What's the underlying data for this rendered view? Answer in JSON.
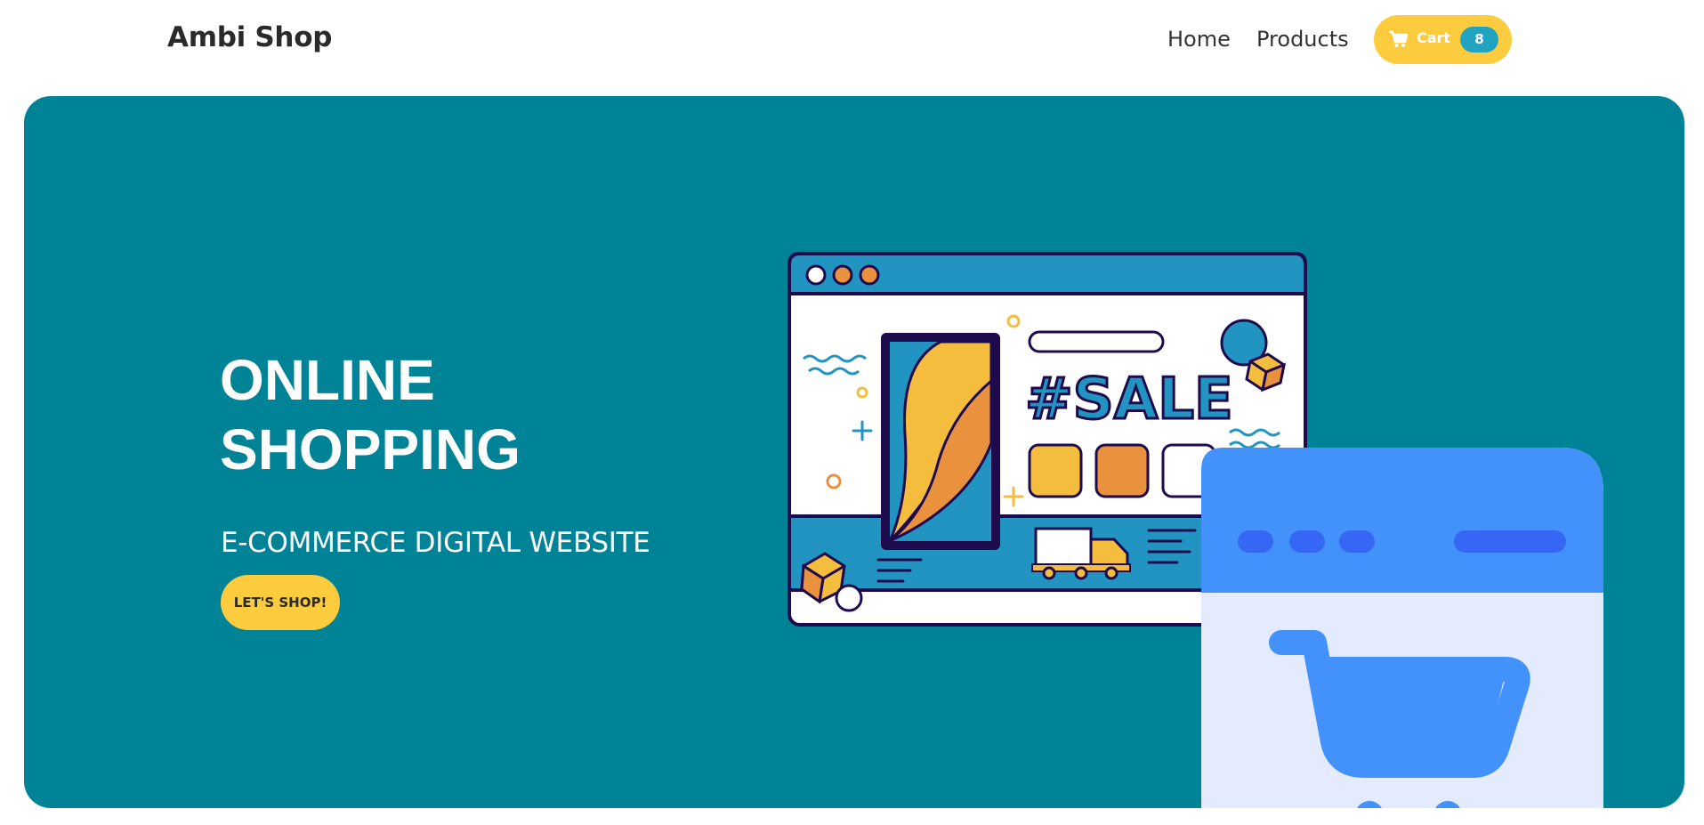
{
  "brand": "Ambi Shop",
  "nav": {
    "home": "Home",
    "products": "Products",
    "cart_label": "Cart",
    "cart_count": "8"
  },
  "hero": {
    "title_line1": "ONLINE",
    "title_line2": "SHOPPING",
    "subtitle": "E-COMMERCE DIGITAL WEBSITE",
    "button": "LET'S SHOP!",
    "illustration_text": "#SALE"
  },
  "colors": {
    "hero_bg": "#008396",
    "accent_yellow": "#fdcc3e",
    "badge_teal": "#21a4c2",
    "cart_blue": "#4392fb",
    "cart_light": "#e4ebfe",
    "illustration_navy": "#1d0b4e",
    "illustration_blue": "#2294c2",
    "illustration_orange": "#ea913d",
    "illustration_yellow": "#f4bd3e"
  },
  "icons": {
    "cart": "cart-icon",
    "truck": "truck-icon",
    "box": "box-icon",
    "arrow": "arrow-right-icon"
  }
}
